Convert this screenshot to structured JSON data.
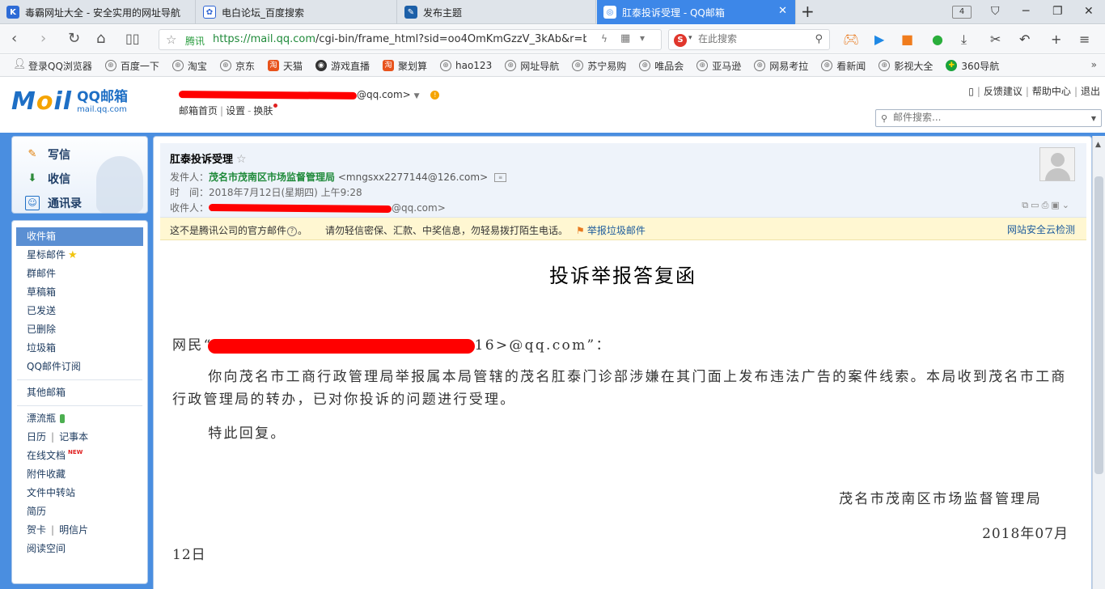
{
  "browser": {
    "tabs": [
      {
        "label": "毒霸网址大全 - 安全实用的网址导航",
        "icon": "k-icon",
        "color": "#2d6bd6",
        "active": false
      },
      {
        "label": "电白论坛_百度搜索",
        "icon": "baidu-paw-icon",
        "color": "#2e64d3",
        "active": false
      },
      {
        "label": "发布主题",
        "icon": "forum-icon",
        "color": "#1c5fa8",
        "active": false
      },
      {
        "label": "肛泰投诉受理 - QQ邮箱",
        "icon": "qqmail-icon",
        "color": "#3d87e8",
        "active": true
      }
    ],
    "tab_count": "4",
    "address": {
      "secure_label": "腾讯",
      "url_prefix": "https://",
      "url_host": "mail.qq.com",
      "url_rest": "/cgi-bin/frame_html?sid=oo4OmKmGzzV_3kAb&r=baC"
    },
    "search": {
      "placeholder": "在此搜索",
      "engine": "S"
    }
  },
  "bookmarks": [
    {
      "label": "登录QQ浏览器",
      "icon": "user-icon"
    },
    {
      "label": "百度一下",
      "icon": "globe-icon"
    },
    {
      "label": "淘宝",
      "icon": "globe-icon"
    },
    {
      "label": "京东",
      "icon": "globe-icon"
    },
    {
      "label": "天猫",
      "icon": "taobao-icon"
    },
    {
      "label": "游戏直播",
      "icon": "game-icon"
    },
    {
      "label": "聚划算",
      "icon": "taobao-icon"
    },
    {
      "label": "hao123",
      "icon": "globe-icon"
    },
    {
      "label": "网址导航",
      "icon": "globe-icon"
    },
    {
      "label": "苏宁易购",
      "icon": "globe-icon"
    },
    {
      "label": "唯品会",
      "icon": "globe-icon"
    },
    {
      "label": "亚马逊",
      "icon": "globe-icon"
    },
    {
      "label": "网易考拉",
      "icon": "globe-icon"
    },
    {
      "label": "看新闻",
      "icon": "globe-icon"
    },
    {
      "label": "影视大全",
      "icon": "globe-icon"
    },
    {
      "label": "360导航",
      "icon": "nav360-icon"
    }
  ],
  "mail": {
    "logo_word_pre": "M",
    "logo_word_o": "o",
    "logo_word_post": "il",
    "logo_title": "QQ邮箱",
    "logo_domain": "mail.qq.com",
    "account_suffix": "@qq.com>",
    "account_links": {
      "home": "邮箱首页",
      "settings": "设置",
      "skin": "换肤"
    },
    "top_links": {
      "feedback": "反馈建议",
      "help": "帮助中心",
      "logout": "退出"
    },
    "search_placeholder": "邮件搜索..."
  },
  "quick_actions": [
    {
      "label": "写信",
      "icon": "compose-icon"
    },
    {
      "label": "收信",
      "icon": "inbox-download-icon"
    },
    {
      "label": "通讯录",
      "icon": "contacts-icon"
    }
  ],
  "folders": {
    "group1": [
      {
        "label": "收件箱",
        "active": true
      },
      {
        "label": "星标邮件",
        "extra": "star"
      },
      {
        "label": "群邮件"
      },
      {
        "label": "草稿箱"
      },
      {
        "label": "已发送"
      },
      {
        "label": "已删除"
      },
      {
        "label": "垃圾箱"
      },
      {
        "label": "QQ邮件订阅"
      }
    ],
    "group2": [
      {
        "label": "其他邮箱"
      }
    ],
    "group3": [
      {
        "label": "漂流瓶",
        "extra": "bottle"
      },
      {
        "label": "日历",
        "label2": "记事本"
      },
      {
        "label": "在线文档",
        "extra": "new",
        "badge": "NEW"
      },
      {
        "label": "附件收藏"
      },
      {
        "label": "文件中转站"
      },
      {
        "label": "简历"
      },
      {
        "label": "贺卡",
        "label2": "明信片"
      },
      {
        "label": "阅读空间"
      }
    ]
  },
  "message": {
    "subject": "肛泰投诉受理",
    "from_label": "发件人：",
    "from_name": "茂名市茂南区市场监督管理局",
    "from_addr": "<mngsxx2277144@126.com>",
    "time_label": "时　间：",
    "time_value": "2018年7月12日(星期四) 上午9:28",
    "to_label": "收件人：",
    "to_suffix": "@qq.com>",
    "notice_part1": "这不是腾讯公司的官方邮件",
    "notice_part2": "。",
    "notice_warning": "请勿轻信密保、汇款、中奖信息，勿轻易拨打陌生电话。",
    "notice_report": "举报垃圾邮件",
    "notice_cloud": "网站安全云检测"
  },
  "letter": {
    "title": "投诉举报答复函",
    "salutation_pre": "网民“",
    "salutation_post": "16>@qq.com”：",
    "body1": "你向茂名市工商行政管理局举报属本局管辖的茂名肛泰门诊部涉嫌在其门面上发布违法广告的案件线索。本局收到茂名市工商行政管理局的转办，已对你投诉的问题进行受理。",
    "body2": "特此回复。",
    "signer": "茂名市茂南区市场监督管理局",
    "date_line1": "2018年07月",
    "date_line2": "12日"
  }
}
